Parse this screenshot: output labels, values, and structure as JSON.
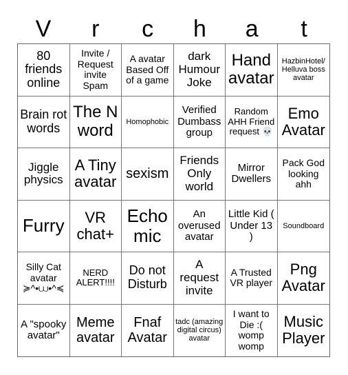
{
  "header": {
    "letters": [
      "V",
      "r",
      "c",
      "h",
      "a",
      "t"
    ]
  },
  "board": {
    "cells": [
      "80 friends online",
      "Invite / Request invite Spam",
      "A avatar Based Off of a game",
      "dark Humour Joke",
      "Hand avatar",
      "HazbinHotel/ Helluva boss avatar",
      "Brain rot words",
      "The N word",
      "Homophobic",
      "Verified Dumbass group",
      "Random AHH Friend request 💀",
      "Emo Avatar",
      "Jiggle physics",
      "A Tiny avatar",
      "sexism",
      "Friends Only world",
      "Mirror Dwellers",
      "Pack God looking ahh",
      "Furry",
      "VR chat+",
      "Echo mic",
      "An overused avatar",
      "Little Kid ( Under 13 )",
      "Soundboard",
      "Silly Cat avatar ≽^•⩊•^≼",
      "NERD ALERT!!!!",
      "Do not Disturb",
      "A request invite",
      "A Trusted VR player",
      "Png Avatar",
      "A \"spooky avatar\"",
      "Meme avatar",
      "Fnaf Avatar",
      "tadc (amazing digital circus) avatar",
      "I want to Die :( womp womp",
      "Music Player"
    ]
  }
}
